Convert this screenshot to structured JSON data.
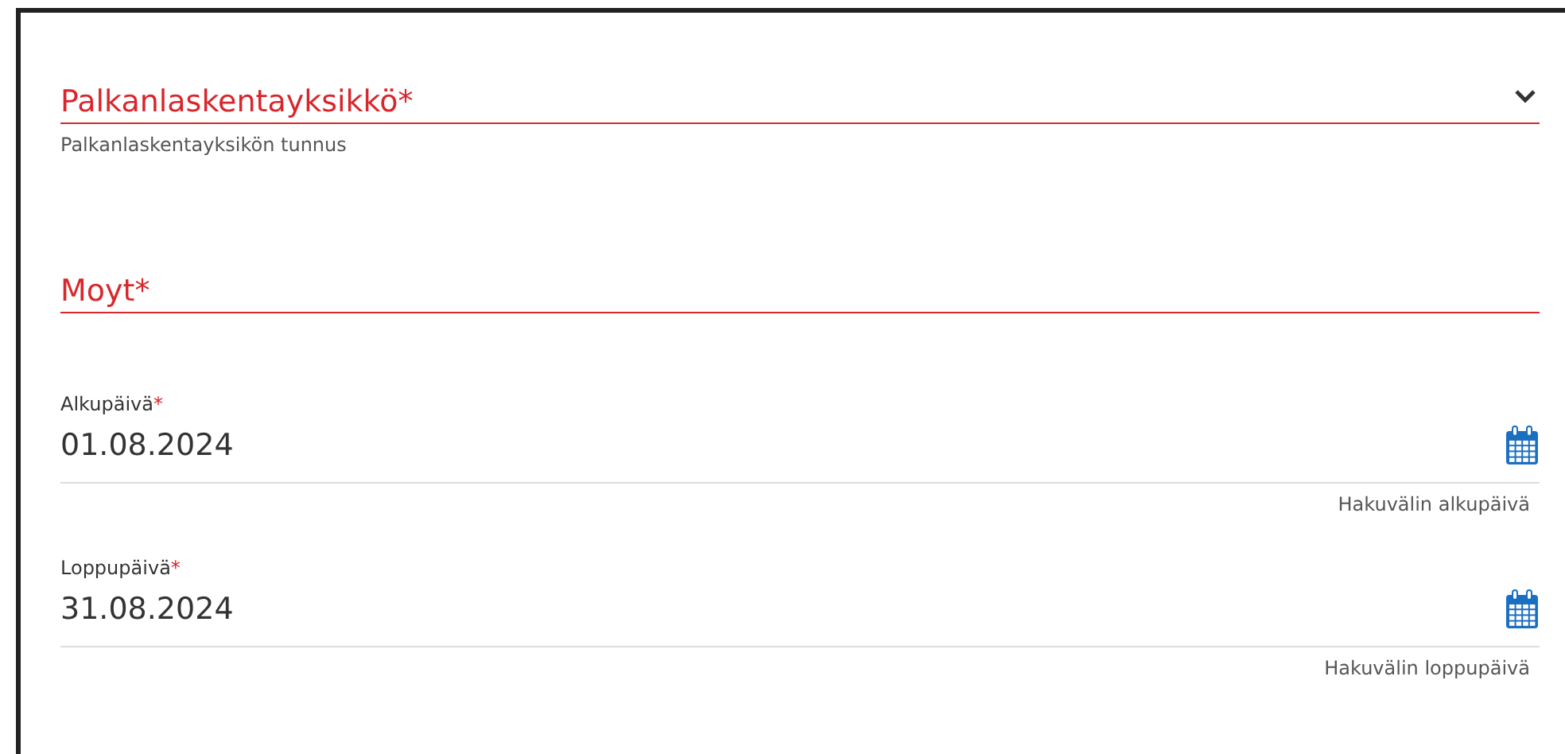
{
  "fields": [
    {
      "kind": "select",
      "label": "Palkanlaskentayksikkö",
      "required_mark": "*",
      "invalid": true,
      "hint": "Palkanlaskentayksikön tunnus"
    },
    {
      "kind": "text",
      "label": "Moyt",
      "required_mark": "*",
      "invalid": true
    },
    {
      "kind": "date",
      "label": "Alkupäivä",
      "required_mark": "*",
      "invalid": false,
      "value": "01.08.2024",
      "hint": "Hakuvälin alkupäivä"
    },
    {
      "kind": "date",
      "label": "Loppupäivä",
      "required_mark": "*",
      "invalid": false,
      "value": "31.08.2024",
      "hint": "Hakuvälin loppupäivä"
    }
  ]
}
